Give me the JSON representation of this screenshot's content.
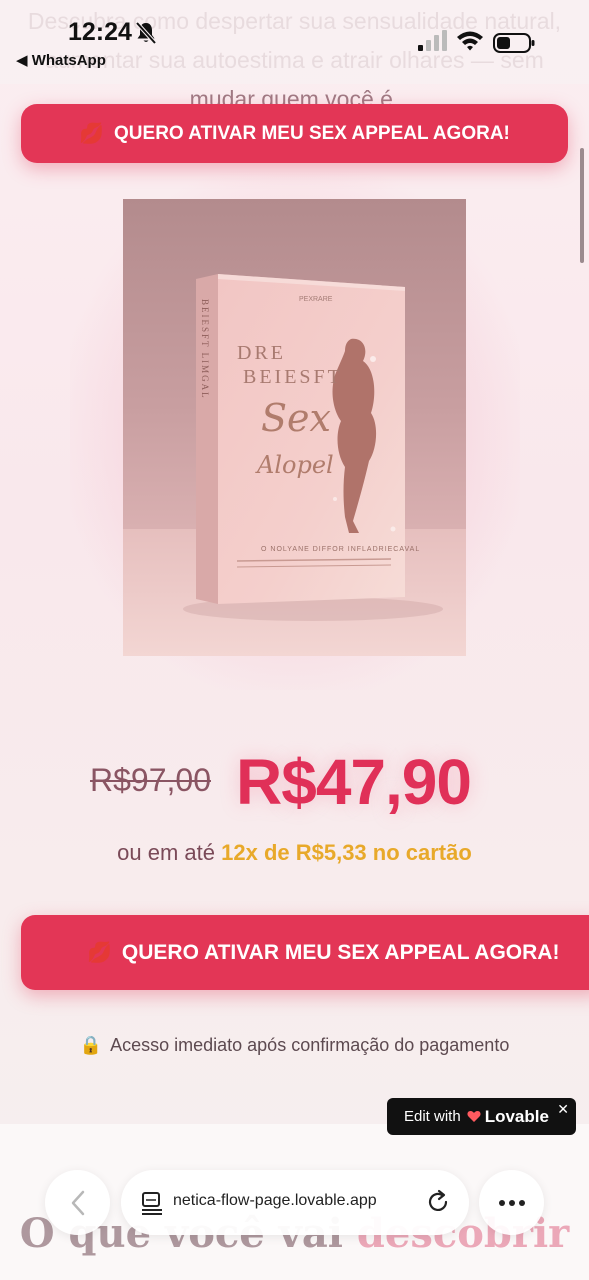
{
  "status_bar": {
    "time": "12:24",
    "back_app": "◀ WhatsApp"
  },
  "intro": {
    "text": "Descubra como despertar sua sensualidade natural, aumentar sua autoestima e atrair olhares — sem mudar quem você é."
  },
  "cta": {
    "label": "QUERO ATIVAR MEU SEX APPEAL AGORA!",
    "icon": "lips-icon",
    "color": "#e33656"
  },
  "product": {
    "cover_title_line1": "DRE",
    "cover_title_line2": "BEIESFT",
    "cover_script1": "Sex",
    "cover_script2": "Alopel",
    "cover_top_text": "PEXRARE",
    "cover_subtitle": "O NOLYANE DIFFOR INFLADRIECAVAL",
    "cover_spine": "BEIESFT LIMGAL"
  },
  "pricing": {
    "old_price": "R$97,00",
    "new_price": "R$47,90",
    "installments_prefix": "ou em até ",
    "installments_highlight": "12x de R$5,33 no cartão",
    "price_color": "#e03058",
    "highlight_color": "#e8a92a"
  },
  "access_note": {
    "icon": "lock-icon",
    "text": "Acesso imediato após confirmação do pagamento"
  },
  "section": {
    "title_main": "O que você vai ",
    "title_accent": "descobrir"
  },
  "lovable_badge": {
    "prefix": "Edit with",
    "brand": "Lovable",
    "close": "✕"
  },
  "browser": {
    "url": "netica-flow-page.lovable.app"
  }
}
